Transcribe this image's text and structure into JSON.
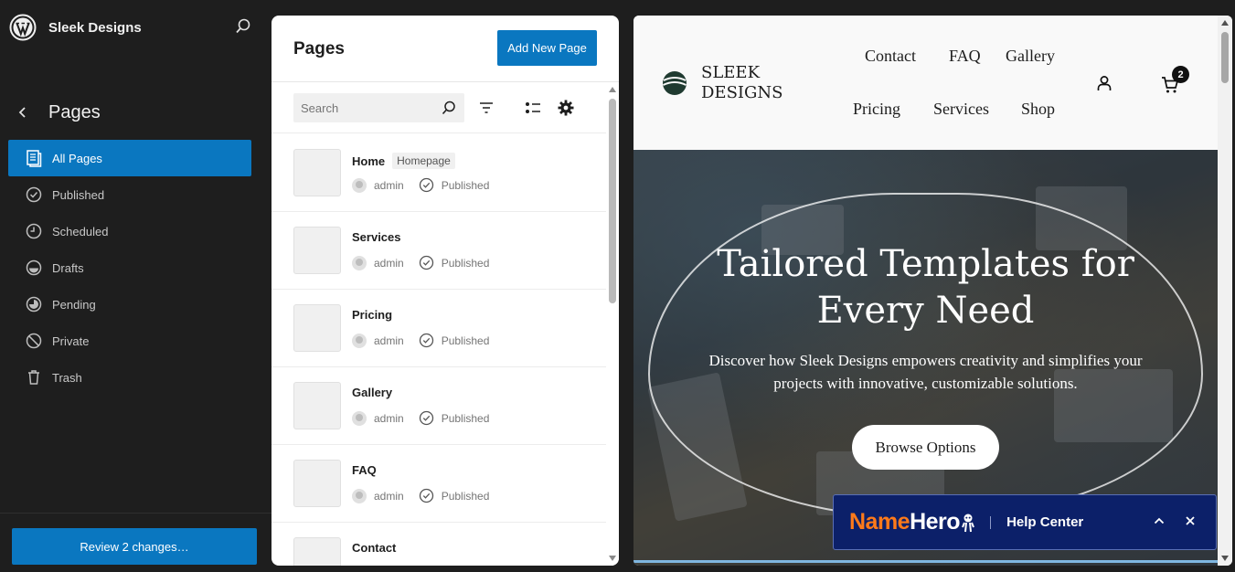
{
  "site": {
    "name": "Sleek Designs"
  },
  "sidebar": {
    "heading": "Pages",
    "items": [
      {
        "label": "All Pages",
        "icon": "pages-icon",
        "active": true
      },
      {
        "label": "Published",
        "icon": "published-icon"
      },
      {
        "label": "Scheduled",
        "icon": "scheduled-icon"
      },
      {
        "label": "Drafts",
        "icon": "drafts-icon"
      },
      {
        "label": "Pending",
        "icon": "pending-icon"
      },
      {
        "label": "Private",
        "icon": "private-icon"
      },
      {
        "label": "Trash",
        "icon": "trash-icon"
      }
    ],
    "review_button": "Review 2 changes…"
  },
  "pages_panel": {
    "title": "Pages",
    "add_button": "Add New Page",
    "search_placeholder": "Search",
    "rows": [
      {
        "title": "Home",
        "badge": "Homepage",
        "author": "admin",
        "status": "Published"
      },
      {
        "title": "Services",
        "author": "admin",
        "status": "Published"
      },
      {
        "title": "Pricing",
        "author": "admin",
        "status": "Published"
      },
      {
        "title": "Gallery",
        "author": "admin",
        "status": "Published"
      },
      {
        "title": "FAQ",
        "author": "admin",
        "status": "Published"
      },
      {
        "title": "Contact"
      }
    ]
  },
  "preview": {
    "brand_line1": "SLEEK",
    "brand_line2": "DESIGNS",
    "nav": [
      "Contact",
      "FAQ",
      "Gallery",
      "Pricing",
      "Services",
      "Shop"
    ],
    "cart_count": "2",
    "hero_title_line1": "Tailored Templates for",
    "hero_title_line2": "Every Need",
    "hero_sub_line1": "Discover how Sleek Designs empowers creativity and simplifies your",
    "hero_sub_line2": "projects with innovative, customizable solutions.",
    "hero_button": "Browse Options"
  },
  "help_widget": {
    "brand_part1": "Name",
    "brand_part2": "Hero",
    "label": "Help Center"
  },
  "colors": {
    "admin_accent": "#0a77c0",
    "sidebar_bg": "#1e1e1e",
    "help_bg": "#0c2069",
    "namehero_orange": "#ff7a1a"
  }
}
